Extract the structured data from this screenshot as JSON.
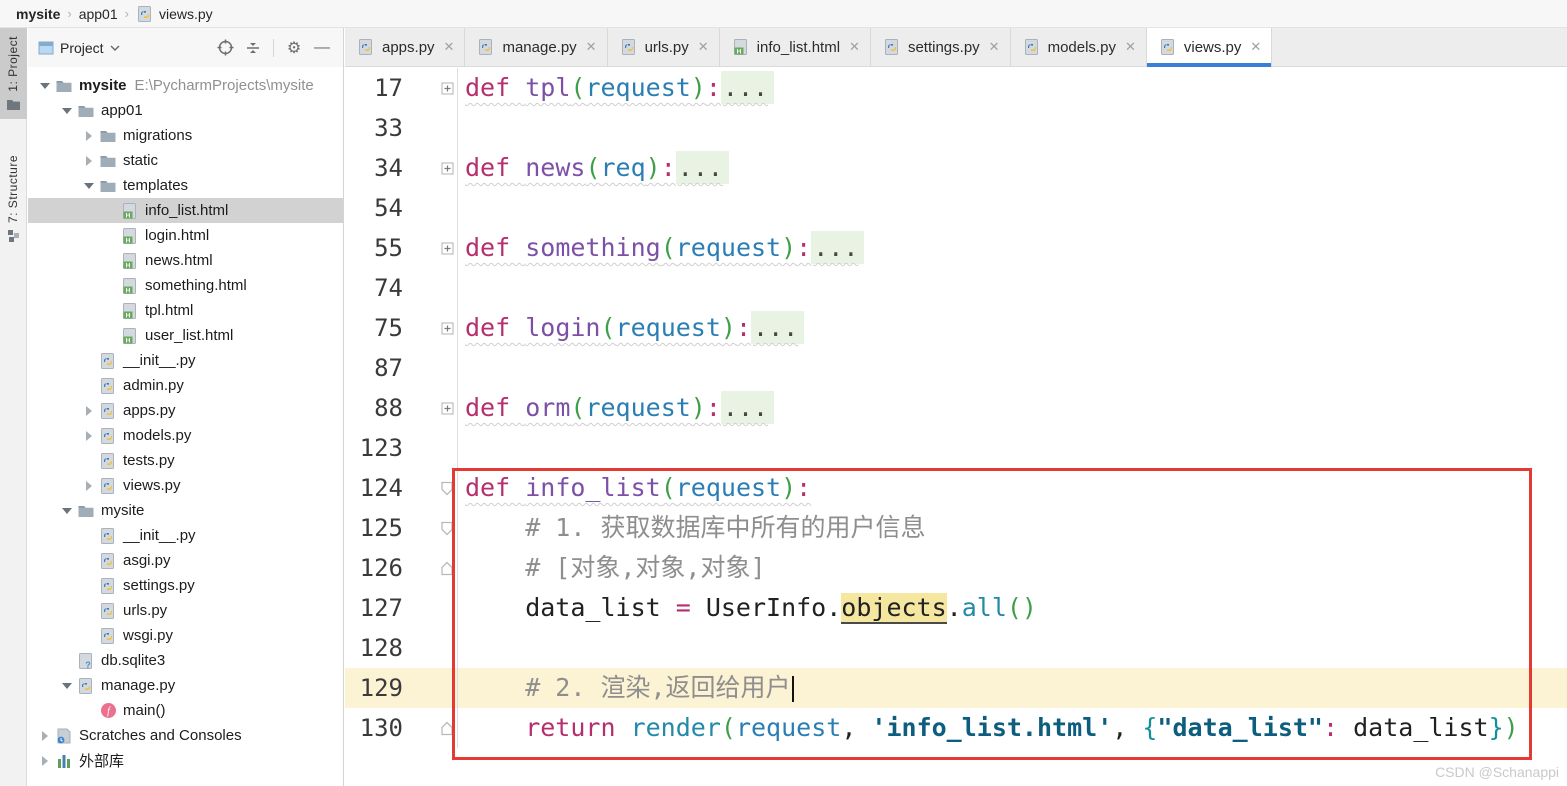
{
  "palette": {
    "accent_tab_underline": "#3a7fd5",
    "annotation_red": "#e53935",
    "current_line_bg": "#fcf2d4",
    "folded_region_bg": "#e8f3e3",
    "identifier_highlight_bg": "#f5e6a0",
    "keyword_color": "#b52e6e",
    "function_name_color": "#7d50a8",
    "parameter_color": "#2b7eb3",
    "call_color": "#2289a9",
    "paren_color": "#3f9e4a",
    "brace_color": "#12919b",
    "string_color": "#0c5d7e",
    "comment_color": "#8e8e8e"
  },
  "breadcrumb": {
    "items": [
      {
        "label": "mysite",
        "bold": true
      },
      {
        "label": "app01"
      },
      {
        "label": "views.py",
        "icon": "python"
      }
    ]
  },
  "stripe": {
    "project_label": "1: Project",
    "structure_label": "7: Structure"
  },
  "project_panel": {
    "title": "Project",
    "tree": [
      {
        "label": "mysite",
        "suffix": "E:\\PycharmProjects\\mysite",
        "icon": "folder",
        "level": 0,
        "arrow": "expanded",
        "bold": true
      },
      {
        "label": "app01",
        "icon": "folder",
        "level": 1,
        "arrow": "expanded"
      },
      {
        "label": "migrations",
        "icon": "folder",
        "level": 2,
        "arrow": "collapsed"
      },
      {
        "label": "static",
        "icon": "folder",
        "level": 2,
        "arrow": "collapsed"
      },
      {
        "label": "templates",
        "icon": "folder",
        "level": 2,
        "arrow": "expanded"
      },
      {
        "label": "info_list.html",
        "icon": "html",
        "level": 3,
        "selected": true
      },
      {
        "label": "login.html",
        "icon": "html",
        "level": 3
      },
      {
        "label": "news.html",
        "icon": "html",
        "level": 3
      },
      {
        "label": "something.html",
        "icon": "html",
        "level": 3
      },
      {
        "label": "tpl.html",
        "icon": "html",
        "level": 3
      },
      {
        "label": "user_list.html",
        "icon": "html",
        "level": 3
      },
      {
        "label": "__init__.py",
        "icon": "python",
        "level": 2
      },
      {
        "label": "admin.py",
        "icon": "python",
        "level": 2
      },
      {
        "label": "apps.py",
        "icon": "python",
        "level": 2,
        "arrow": "collapsed"
      },
      {
        "label": "models.py",
        "icon": "python",
        "level": 2,
        "arrow": "collapsed"
      },
      {
        "label": "tests.py",
        "icon": "python",
        "level": 2
      },
      {
        "label": "views.py",
        "icon": "python",
        "level": 2,
        "arrow": "collapsed"
      },
      {
        "label": "mysite",
        "icon": "folder",
        "level": 1,
        "arrow": "expanded"
      },
      {
        "label": "__init__.py",
        "icon": "python",
        "level": 2
      },
      {
        "label": "asgi.py",
        "icon": "python",
        "level": 2
      },
      {
        "label": "settings.py",
        "icon": "python",
        "level": 2
      },
      {
        "label": "urls.py",
        "icon": "python",
        "level": 2
      },
      {
        "label": "wsgi.py",
        "icon": "python",
        "level": 2
      },
      {
        "label": "db.sqlite3",
        "icon": "db",
        "level": 1
      },
      {
        "label": "manage.py",
        "icon": "python",
        "level": 1,
        "arrow": "expanded"
      },
      {
        "label": "main()",
        "icon": "function",
        "level": 2
      },
      {
        "label": "Scratches and Consoles",
        "icon": "scratch",
        "level": 0,
        "arrow": "collapsed"
      },
      {
        "label": "外部库",
        "icon": "library",
        "level": 0,
        "arrow": "collapsed"
      }
    ]
  },
  "tabs": [
    {
      "label": "apps.py",
      "icon": "python"
    },
    {
      "label": "manage.py",
      "icon": "python"
    },
    {
      "label": "urls.py",
      "icon": "python"
    },
    {
      "label": "info_list.html",
      "icon": "html"
    },
    {
      "label": "settings.py",
      "icon": "python"
    },
    {
      "label": "models.py",
      "icon": "python"
    },
    {
      "label": "views.py",
      "icon": "python",
      "active": true
    }
  ],
  "editor": {
    "lines": [
      {
        "num": "17",
        "fold": "plus",
        "wavy": true,
        "tokens": [
          [
            "kw",
            "def "
          ],
          [
            "fn",
            "tpl"
          ],
          [
            "par",
            "("
          ],
          [
            "pr",
            "request"
          ],
          [
            "par",
            ")"
          ],
          [
            "op",
            ":"
          ],
          [
            "fold-dots",
            "..."
          ]
        ]
      },
      {
        "num": "33",
        "tokens": []
      },
      {
        "num": "34",
        "fold": "plus",
        "wavy": true,
        "tokens": [
          [
            "kw",
            "def "
          ],
          [
            "fn",
            "news"
          ],
          [
            "par",
            "("
          ],
          [
            "pr",
            "req"
          ],
          [
            "par",
            ")"
          ],
          [
            "op",
            ":"
          ],
          [
            "fold-dots",
            "..."
          ]
        ]
      },
      {
        "num": "54",
        "tokens": []
      },
      {
        "num": "55",
        "fold": "plus",
        "wavy": true,
        "tokens": [
          [
            "kw",
            "def "
          ],
          [
            "fn",
            "something"
          ],
          [
            "par",
            "("
          ],
          [
            "pr",
            "request"
          ],
          [
            "par",
            ")"
          ],
          [
            "op",
            ":"
          ],
          [
            "fold-dots",
            "..."
          ]
        ]
      },
      {
        "num": "74",
        "tokens": []
      },
      {
        "num": "75",
        "fold": "plus",
        "wavy": true,
        "tokens": [
          [
            "kw",
            "def "
          ],
          [
            "fn",
            "login"
          ],
          [
            "par",
            "("
          ],
          [
            "pr",
            "request"
          ],
          [
            "par",
            ")"
          ],
          [
            "op",
            ":"
          ],
          [
            "fold-dots",
            "..."
          ]
        ]
      },
      {
        "num": "87",
        "tokens": []
      },
      {
        "num": "88",
        "fold": "plus",
        "wavy": true,
        "tokens": [
          [
            "kw",
            "def "
          ],
          [
            "fn",
            "orm"
          ],
          [
            "par",
            "("
          ],
          [
            "pr",
            "request"
          ],
          [
            "par",
            ")"
          ],
          [
            "op",
            ":"
          ],
          [
            "fold-dots",
            "..."
          ]
        ]
      },
      {
        "num": "123",
        "tokens": []
      },
      {
        "num": "124",
        "fold": "down",
        "wavy": true,
        "tokens": [
          [
            "kw",
            "def "
          ],
          [
            "fn",
            "info_list"
          ],
          [
            "par",
            "("
          ],
          [
            "pr",
            "request"
          ],
          [
            "par",
            ")"
          ],
          [
            "op",
            ":"
          ]
        ]
      },
      {
        "num": "125",
        "fold": "down",
        "tokens": [
          [
            "cmt",
            "    # 1. 获取数据库中所有的用户信息"
          ]
        ]
      },
      {
        "num": "126",
        "fold": "up",
        "tokens": [
          [
            "cmt",
            "    # [对象,对象,对象]"
          ]
        ]
      },
      {
        "num": "127",
        "tokens": [
          [
            "pln",
            "    data_list "
          ],
          [
            "op",
            "= "
          ],
          [
            "pln",
            "UserInfo."
          ],
          [
            "hl",
            "objects"
          ],
          [
            "pln",
            "."
          ],
          [
            "call",
            "all"
          ],
          [
            "par",
            "()"
          ]
        ]
      },
      {
        "num": "128",
        "tokens": []
      },
      {
        "num": "129",
        "current": true,
        "caret": true,
        "tokens": [
          [
            "cmt",
            "    # 2. 渲染,返回给用户"
          ]
        ]
      },
      {
        "num": "130",
        "fold": "up",
        "tokens": [
          [
            "kw",
            "    return "
          ],
          [
            "call",
            "render"
          ],
          [
            "par",
            "("
          ],
          [
            "pr",
            "request"
          ],
          [
            "pln",
            ", "
          ],
          [
            "str",
            "'info_list.html'"
          ],
          [
            "pln",
            ", "
          ],
          [
            "brace",
            "{"
          ],
          [
            "str",
            "\"data_list\""
          ],
          [
            "op",
            ":"
          ],
          [
            "pln",
            " data_list"
          ],
          [
            "brace",
            "}"
          ],
          [
            "par",
            ")"
          ]
        ]
      }
    ]
  },
  "watermark": "CSDN @Schanappi"
}
